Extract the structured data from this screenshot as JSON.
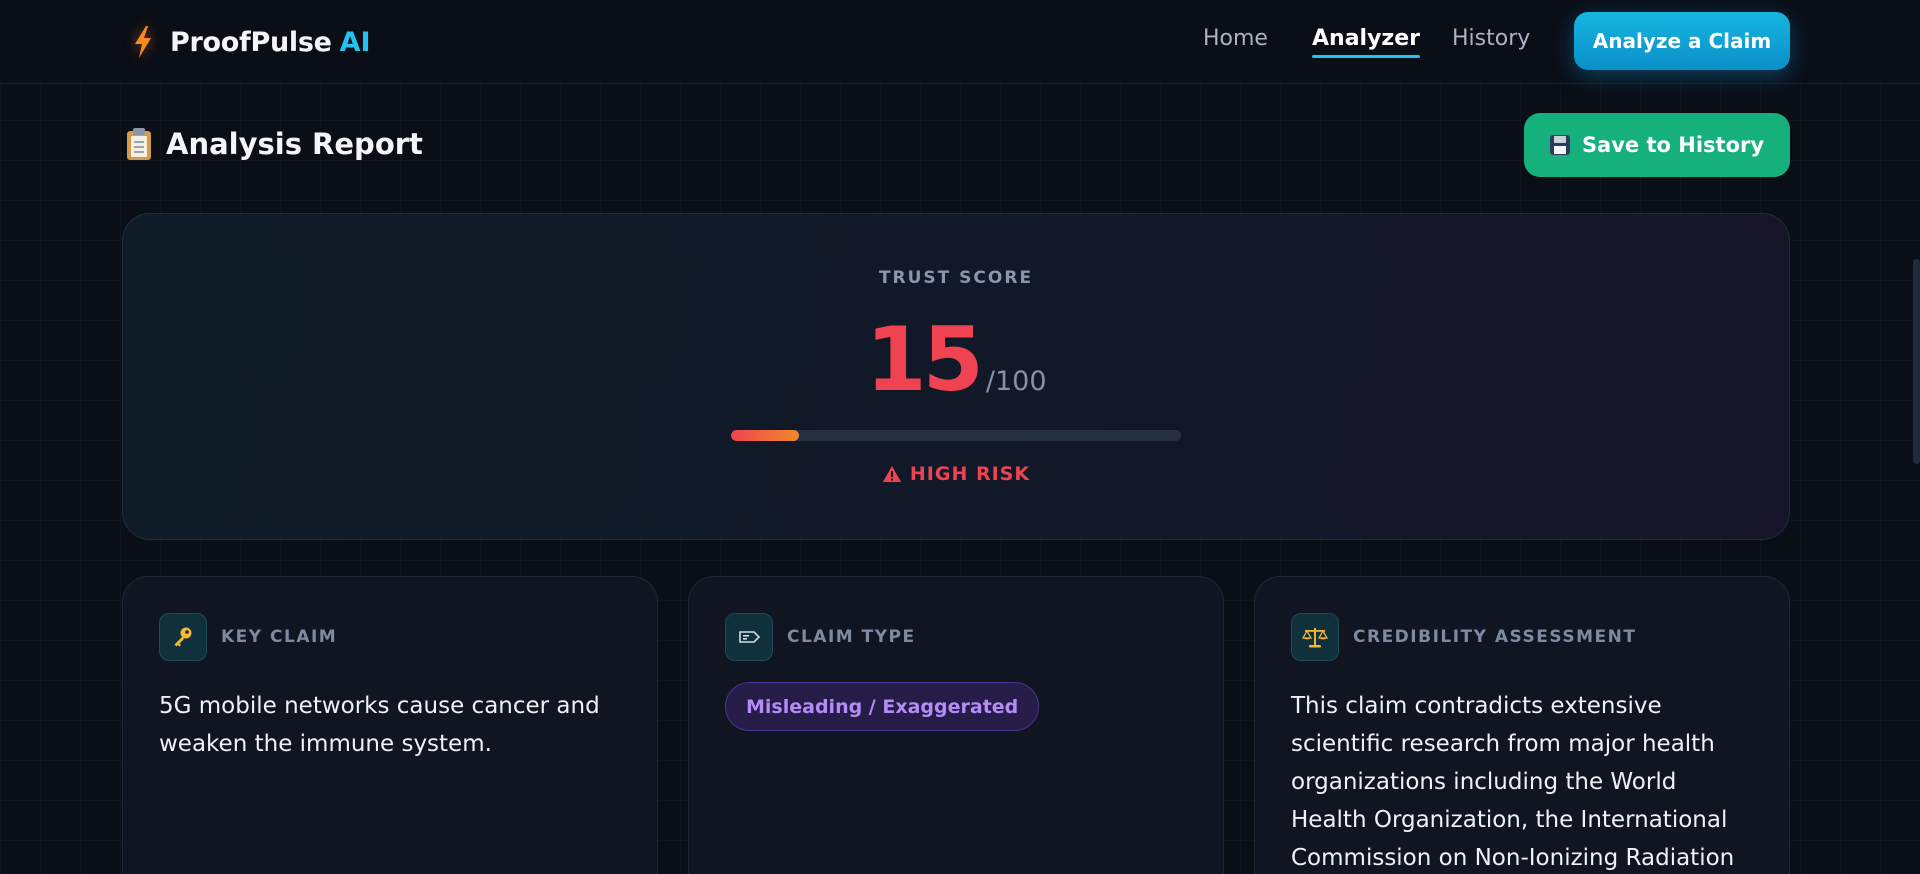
{
  "header": {
    "brand_name": "ProofPulse",
    "brand_suffix": "AI",
    "nav": [
      {
        "label": "Home",
        "active": false
      },
      {
        "label": "Analyzer",
        "active": true
      },
      {
        "label": "History",
        "active": false
      }
    ],
    "cta_label": "Analyze a Claim"
  },
  "report": {
    "title": "Analysis Report",
    "save_label": "Save to History"
  },
  "trust": {
    "label": "TRUST SCORE",
    "score": "15",
    "max": "/100",
    "progress_fraction": 0.15,
    "risk_label": "HIGH RISK"
  },
  "cards": {
    "key_claim": {
      "label": "KEY CLAIM",
      "text": "5G mobile networks cause cancer and weaken the immune system."
    },
    "claim_type": {
      "label": "CLAIM TYPE",
      "value": "Misleading / Exaggerated"
    },
    "credibility": {
      "label": "CREDIBILITY ASSESSMENT",
      "text": "This claim contradicts extensive scientific research from major health organizations including the World Health Organization, the International Commission on Non-Ionizing Radiation Protection, and"
    }
  },
  "colors": {
    "accent": "#22c3ee",
    "danger": "#ef4351",
    "success": "#16b07c",
    "purple": "#b48cf6"
  },
  "icons": {
    "brand": "lightning-bolt-icon",
    "report": "clipboard-icon",
    "save": "floppy-disk-icon",
    "risk": "warning-triangle-icon",
    "key_claim": "key-icon",
    "claim_type": "tag-icon",
    "credibility": "balance-scale-icon"
  }
}
